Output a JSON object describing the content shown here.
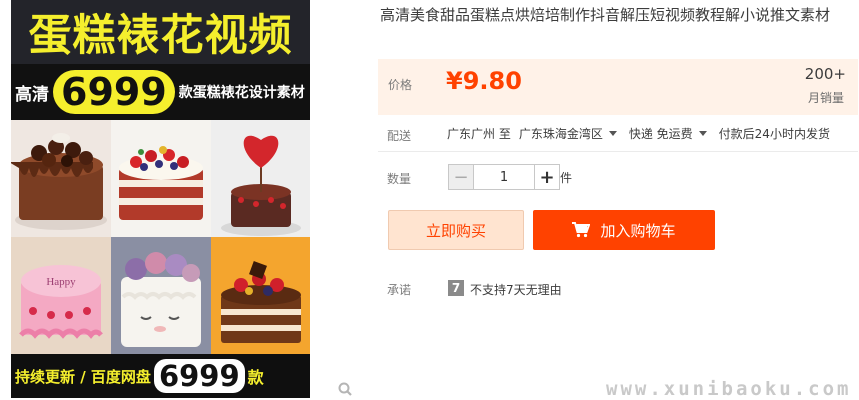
{
  "poster": {
    "title": "蛋糕裱花视频",
    "sub_prefix": "高清",
    "sub_number": "6999",
    "sub_suffix": "款蛋糕裱花设计素材",
    "footer_text": "持续更新 / 百度网盘",
    "footer_number": "6999",
    "footer_suffix": "款",
    "colors": {
      "accent_yellow": "#f5ef2d",
      "dark": "#111111"
    }
  },
  "product": {
    "title": "高清美食甜品蛋糕点烘焙培制作抖音解压短视频教程解小说推文素材",
    "price_label": "价格",
    "price": "¥9.80",
    "sales_count": "200+",
    "sales_label": "月销量",
    "shipping_label": "配送",
    "ship_from": "广东广州 至",
    "ship_to": "广东珠海金湾区",
    "ship_method": "快递 免运费",
    "ship_time": "付款后24小时内发货",
    "quantity_label": "数量",
    "quantity_value": "1",
    "quantity_unit": "件",
    "buy_now_label": "立即购买",
    "add_to_cart_label": "加入购物车",
    "promise_label": "承诺",
    "promise_badge": "7",
    "promise_text": "不支持7天无理由",
    "colors": {
      "price": "#ff4200",
      "price_bg": "#fff2e8"
    }
  },
  "watermark": "www.xunibaoku.com",
  "icons": [
    "magnifier-zoom-icon",
    "shopping-cart-icon",
    "no-7-day-return-icon",
    "minus-icon",
    "plus-icon",
    "dropdown-caret-icon"
  ]
}
